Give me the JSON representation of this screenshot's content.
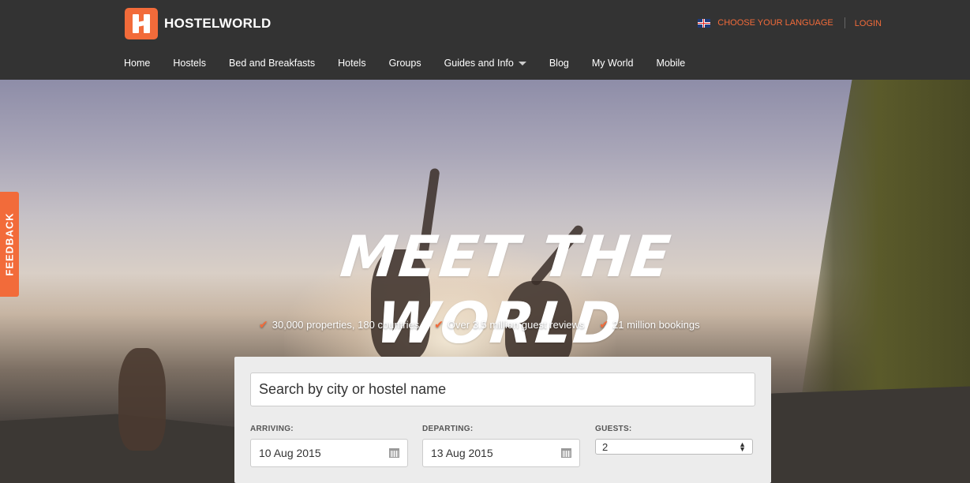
{
  "header": {
    "brand": "HOSTELWORLD",
    "language_link": "CHOOSE YOUR LANGUAGE",
    "login_link": "LOGIN",
    "nav": [
      {
        "label": "Home"
      },
      {
        "label": "Hostels"
      },
      {
        "label": "Bed and Breakfasts"
      },
      {
        "label": "Hotels"
      },
      {
        "label": "Groups"
      },
      {
        "label": "Guides and Info"
      },
      {
        "label": "Blog"
      },
      {
        "label": "My World"
      },
      {
        "label": "Mobile"
      }
    ]
  },
  "feedback_tab": "FEEDBACK",
  "hero": {
    "headline": "MEET THE WORLD",
    "features": [
      "30,000 properties, 180 countries",
      "Over 3.5 million guest reviews",
      "21 million bookings"
    ]
  },
  "search": {
    "placeholder": "Search by city or hostel name",
    "arriving_label": "ARRIVING:",
    "arriving_value": "10 Aug 2015",
    "departing_label": "DEPARTING:",
    "departing_value": "13 Aug 2015",
    "guests_label": "GUESTS:",
    "guests_value": "2"
  },
  "colors": {
    "accent": "#f26b3a",
    "header_bg": "#333333"
  },
  "icons": [
    "hostelworld-logo-icon",
    "uk-flag-icon",
    "caret-down-icon",
    "check-icon",
    "calendar-icon",
    "select-arrows-icon"
  ]
}
